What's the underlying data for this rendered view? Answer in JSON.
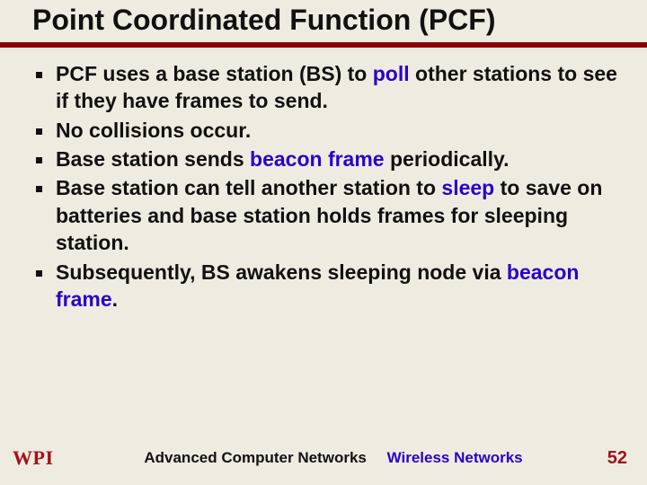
{
  "title": "Point Coordinated Function (PCF)",
  "bullets": [
    {
      "pre": "PCF uses a base station (BS) to ",
      "kw": "poll",
      "post": " other stations to see if they have frames to send."
    },
    {
      "pre": "No collisions occur.",
      "kw": "",
      "post": ""
    },
    {
      "pre": "Base station sends ",
      "kw": "beacon frame",
      "post": " periodically."
    },
    {
      "pre": "Base station can tell another station to ",
      "kw": "sleep",
      "post": " to save on batteries and base station holds frames for sleeping station."
    },
    {
      "pre": "Subsequently, BS awakens sleeping node via ",
      "kw": "beacon frame",
      "post": "."
    }
  ],
  "footer": {
    "logo": "WPI",
    "course": "Advanced Computer Networks",
    "topic": "Wireless Networks",
    "page": "52"
  }
}
